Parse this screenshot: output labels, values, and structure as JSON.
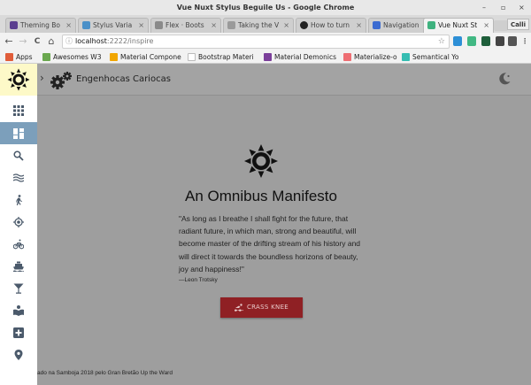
{
  "window": {
    "title": "Vue Nuxt Stylus Beguile Us - Google Chrome",
    "controls": [
      "–",
      "▫",
      "×"
    ]
  },
  "tabs": [
    {
      "label": "Theming Bo",
      "favicon_color": "#5b3f8f"
    },
    {
      "label": "Stylus Varia",
      "favicon_color": "#4a90c8"
    },
    {
      "label": "Flex · Boots",
      "favicon_color": "#8a8a8a"
    },
    {
      "label": "Taking the V",
      "favicon_color": "#9a9a9a"
    },
    {
      "label": "How to turn",
      "favicon_color": "#222222"
    },
    {
      "label": "Navigation",
      "favicon_color": "#3b6bd1"
    },
    {
      "label": "Vue Nuxt St",
      "favicon_color": "#3fb27f",
      "active": true
    }
  ],
  "tab_close": "×",
  "profile_label": "Calli",
  "address": {
    "host": "localhost",
    "path": ":2222/inspire",
    "info_icon": "ⓘ",
    "star_icon": "☆"
  },
  "nav_icons": {
    "back": "←",
    "forward": "→",
    "reload": "C",
    "home": "⌂"
  },
  "extensions": [
    {
      "name": "vue-devtools-icon",
      "color": "#2d8fd6"
    },
    {
      "name": "nuxt-icon",
      "color": "#41b883"
    },
    {
      "name": "mountain-icon",
      "color": "#1e5e3a"
    },
    {
      "name": "cookie-icon",
      "color": "#444444"
    },
    {
      "name": "shield-icon",
      "color": "#555555"
    },
    {
      "name": "menu-icon",
      "color": "#666666"
    }
  ],
  "bookmarks": [
    {
      "label": "Apps",
      "color": "#e05d3a"
    },
    {
      "label": "Awesomes W3",
      "color": "#6aa84f"
    },
    {
      "label": "Material Compone",
      "color": "#f1a600"
    },
    {
      "label": "Bootstrap Materi",
      "color": "#bbbbbb"
    },
    {
      "label": "Material Demonics",
      "color": "#7b3f9a"
    },
    {
      "label": "Materialize-o",
      "color": "#ee6e73"
    },
    {
      "label": "Semantical Yo",
      "color": "#35bdb2"
    }
  ],
  "app": {
    "toolbar_title": "Engenhocas Cariocas",
    "headline": "An Omnibus Manifesto",
    "quote": "\"As long as I breathe I shall fight for the future, that radiant future, in which man, strong and beautiful, will become master of the drifting stream of his history and will direct it towards the boundless horizons of beauty, joy and happiness!\"",
    "cite": "—Leon Trotsky",
    "cta_label": "CRASS KNEE",
    "footer": "ado na Samboja 2018 pelo Gran Bretão Up the Ward",
    "chevron": "›"
  },
  "sidebar_items": [
    {
      "name": "apps-grid-icon"
    },
    {
      "name": "dashboard-icon",
      "active": true
    },
    {
      "name": "search-icon"
    },
    {
      "name": "waves-icon"
    },
    {
      "name": "walking-icon"
    },
    {
      "name": "target-icon"
    },
    {
      "name": "bicycle-icon"
    },
    {
      "name": "ferry-icon"
    },
    {
      "name": "cocktail-icon"
    },
    {
      "name": "book-icon"
    },
    {
      "name": "add-box-icon"
    },
    {
      "name": "place-icon"
    }
  ],
  "colors": {
    "overlay": "#9e9e9e",
    "cta": "#8f2024",
    "sidebar_active": "#7c9fbb",
    "logo_bg": "#fdf9c8"
  }
}
